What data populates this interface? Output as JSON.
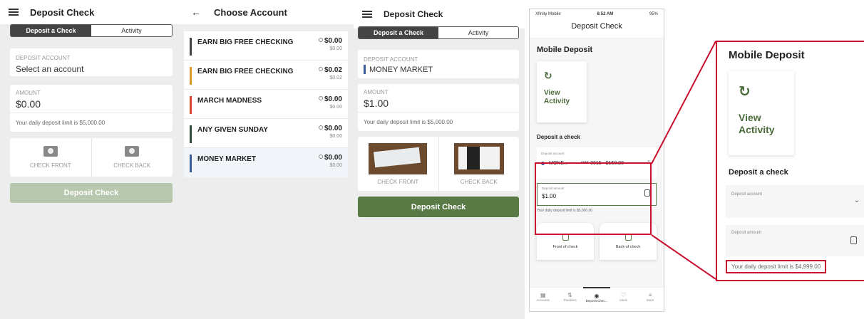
{
  "screen1": {
    "title": "Deposit Check",
    "tab_deposit": "Deposit a Check",
    "tab_activity": "Activity",
    "deposit_account_label": "DEPOSIT ACCOUNT",
    "deposit_account_value": "Select an account",
    "amount_label": "AMOUNT",
    "amount_value": "$0.00",
    "limit_text": "Your daily deposit limit is $5,000.00",
    "check_front": "CHECK FRONT",
    "check_back": "CHECK BACK",
    "deposit_button": "Deposit Check"
  },
  "screen2": {
    "title": "Choose Account",
    "accounts": [
      {
        "name": "EARN BIG FREE CHECKING",
        "balance": "$0.00",
        "sub": "$0.00",
        "color": "#444444"
      },
      {
        "name": "EARN BIG FREE CHECKING",
        "balance": "$0.02",
        "sub": "$0.02",
        "color": "#e0962e"
      },
      {
        "name": "MARCH MADNESS",
        "balance": "$0.00",
        "sub": "$0.00",
        "color": "#d2462f"
      },
      {
        "name": "ANY GIVEN SUNDAY",
        "balance": "$0.00",
        "sub": "$0.00",
        "color": "#2f4a3a"
      },
      {
        "name": "MONEY MARKET",
        "balance": "$0.00",
        "sub": "$0.00",
        "color": "#3a5a99"
      }
    ]
  },
  "screen3": {
    "title": "Deposit Check",
    "tab_deposit": "Deposit a Check",
    "tab_activity": "Activity",
    "deposit_account_label": "DEPOSIT ACCOUNT",
    "deposit_account_value": "MONEY MARKET",
    "amount_label": "AMOUNT",
    "amount_value": "$1.00",
    "limit_text": "Your daily deposit limit is $5,000.00",
    "check_front": "CHECK FRONT",
    "check_back": "CHECK BACK",
    "deposit_button": "Deposit Check"
  },
  "screen4": {
    "carrier": "Xfinity Mobile",
    "time": "6:52 AM",
    "battery": "95%",
    "title": "Deposit Check",
    "heading": "Mobile Deposit",
    "view_activity": "View Activity",
    "deposit_a_check": "Deposit a check",
    "deposit_account_label": "Deposit account",
    "account_name": "MONE...",
    "account_number": "****-0015",
    "account_balance": "$150.28",
    "deposit_amount_label": "Deposit amount",
    "deposit_amount_value": "$1.00",
    "limit_text": "Your daily deposit limit is $5,000.00",
    "front_of_check": "Front of check",
    "back_of_check": "Back of check",
    "nav": [
      "Accounts",
      "Transfers",
      "Deposit Chec...",
      "Alerts",
      "More"
    ]
  },
  "screen5": {
    "heading": "Mobile Deposit",
    "view_activity": "View Activity",
    "deposit_a_check": "Deposit a check",
    "deposit_account_label": "Deposit account",
    "deposit_amount_label": "Deposit amount",
    "limit_text": "Your daily deposit limit is $4,999.00"
  },
  "colors": {
    "brand_green": "#5a7a45",
    "disabled_green": "#b7c8ae",
    "highlight_red": "#c8102e"
  }
}
